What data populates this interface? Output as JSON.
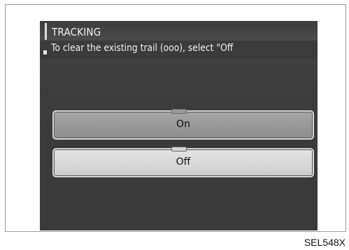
{
  "screen": {
    "title": "TRACKING",
    "message": "To clear the existing trail (ooo), select \"Off",
    "options": [
      {
        "label": "On",
        "selected": false
      },
      {
        "label": "Off",
        "selected": true
      }
    ]
  },
  "caption": "SEL548X",
  "colors": {
    "screen_background": "#3a3a3a",
    "on_button": "#999999",
    "off_button_selected": "#d9d9d9",
    "text_light": "#f0f0f0"
  }
}
